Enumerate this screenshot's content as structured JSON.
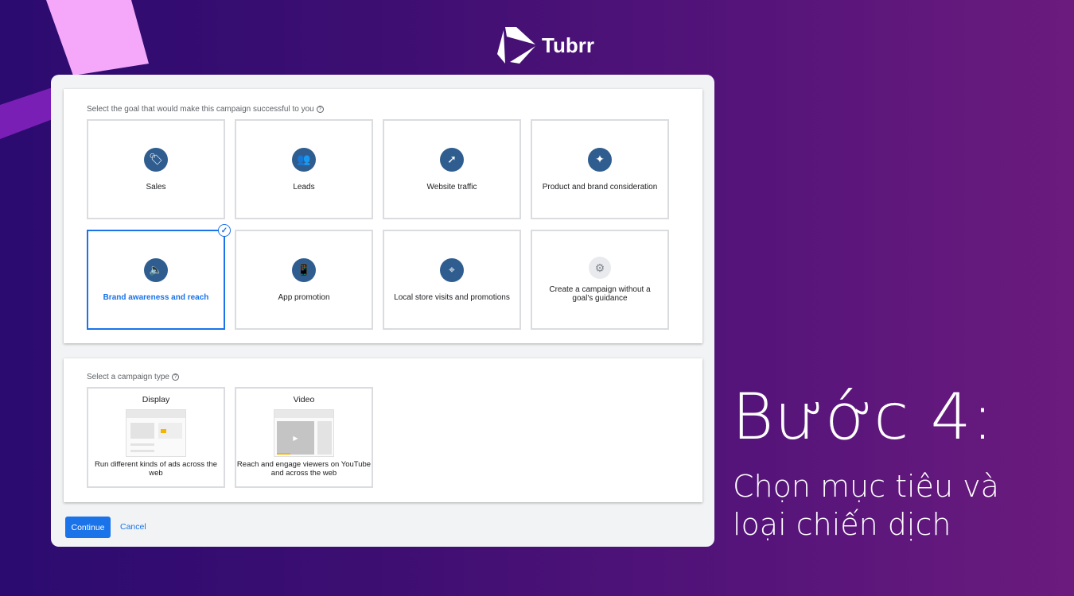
{
  "brand": {
    "name": "Tubrr"
  },
  "goal_section": {
    "label": "Select the goal that would make this campaign successful to you",
    "goals": [
      {
        "label": "Sales",
        "icon": "tag-icon",
        "selected": false
      },
      {
        "label": "Leads",
        "icon": "people-icon",
        "selected": false
      },
      {
        "label": "Website traffic",
        "icon": "cursor-click-icon",
        "selected": false
      },
      {
        "label": "Product and brand consideration",
        "icon": "sparkle-icon",
        "selected": false
      },
      {
        "label": "Brand awareness and reach",
        "icon": "speaker-icon",
        "selected": true
      },
      {
        "label": "App promotion",
        "icon": "phone-download-icon",
        "selected": false
      },
      {
        "label": "Local store visits and promotions",
        "icon": "location-pin-icon",
        "selected": false
      },
      {
        "label": "Create a campaign without a goal's guidance",
        "icon": "gear-icon",
        "selected": false
      }
    ]
  },
  "type_section": {
    "label": "Select a campaign type",
    "types": [
      {
        "title": "Display",
        "desc": "Run different kinds of ads across the web"
      },
      {
        "title": "Video",
        "desc": "Reach and engage viewers on YouTube and across the web"
      }
    ]
  },
  "actions": {
    "continue": "Continue",
    "cancel": "Cancel"
  },
  "headline": {
    "title": "Bước 4:",
    "line1": "Chọn mục tiêu và",
    "line2": "loại chiến dịch"
  },
  "colors": {
    "accent": "#1a73e8",
    "icon_bg": "#2f5d8f"
  }
}
